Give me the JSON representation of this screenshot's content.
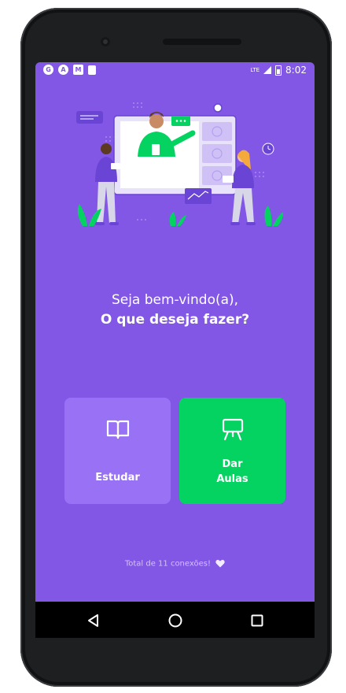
{
  "status_bar": {
    "left_icons": [
      "G",
      "A",
      "M",
      "SD"
    ],
    "network": "LTE",
    "time": "8:02"
  },
  "welcome": {
    "line1": "Seja bem-vindo(a),",
    "line2": "O que deseja fazer?"
  },
  "buttons": {
    "study_label": "Estudar",
    "teach_label_1": "Dar",
    "teach_label_2": "Aulas"
  },
  "footer": {
    "total_text": "Total de 11 conexões!"
  },
  "colors": {
    "background": "#8257e5",
    "study_button": "#9871f5",
    "teach_button": "#04d361",
    "text": "#ffffff"
  },
  "icons": {
    "study": "book-open-icon",
    "teach": "presentation-board-icon",
    "footer": "heart-icon",
    "nav": [
      "back-triangle-icon",
      "home-circle-icon",
      "recents-square-icon"
    ]
  }
}
